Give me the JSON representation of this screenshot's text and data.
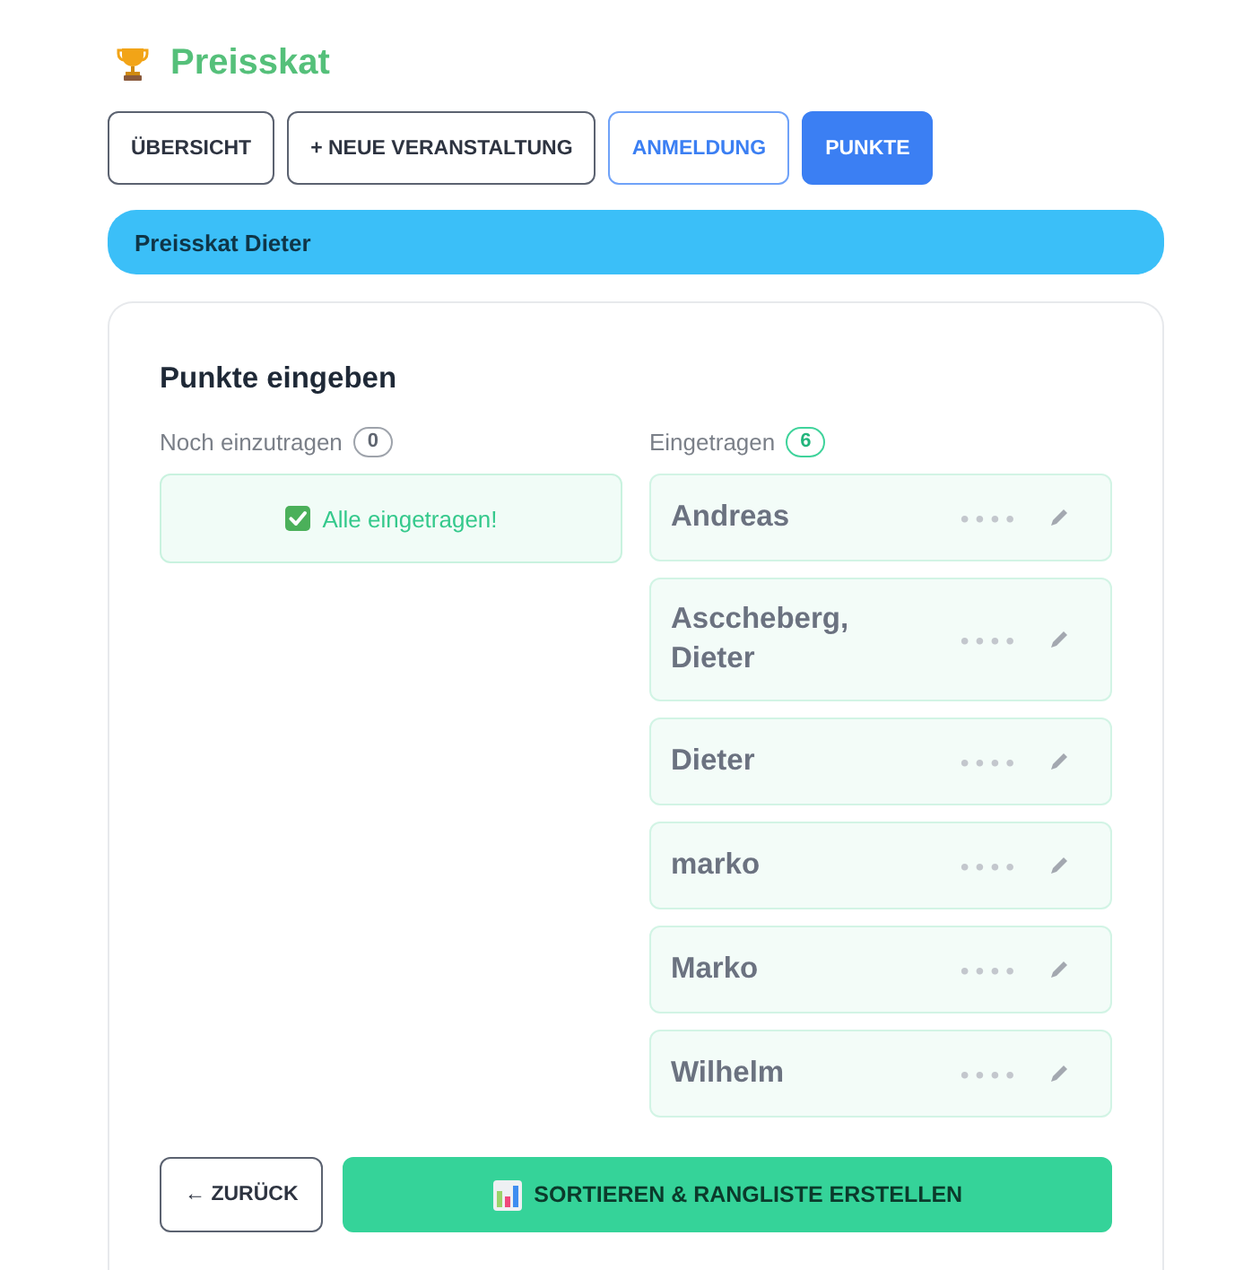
{
  "header": {
    "title": "Preisskat"
  },
  "nav_tabs": [
    {
      "label": "ÜBERSICHT",
      "kind": "neutral",
      "selected": false
    },
    {
      "label": "+ NEUE VERANSTALTUNG",
      "kind": "neutral",
      "selected": false
    },
    {
      "label": "ANMELDUNG",
      "kind": "primary",
      "selected": false
    },
    {
      "label": "PUNKTE",
      "kind": "primary",
      "selected": true
    }
  ],
  "event_banner": {
    "title": "Preisskat Dieter"
  },
  "card": {
    "title": "Punkte eingeben",
    "pending": {
      "label": "Noch einzutragen",
      "count": "0",
      "kind": "neutral",
      "empty_message": "Alle eingetragen!"
    },
    "entered": {
      "label": "Eingetragen",
      "count": "6",
      "kind": "success",
      "players": [
        {
          "name": "Andreas",
          "masked_points": "••••"
        },
        {
          "name": "Asccheberg, Dieter",
          "masked_points": "••••"
        },
        {
          "name": "Dieter",
          "masked_points": "••••"
        },
        {
          "name": "marko",
          "masked_points": "••••"
        },
        {
          "name": "Marko",
          "masked_points": "••••"
        },
        {
          "name": "Wilhelm",
          "masked_points": "••••"
        }
      ]
    },
    "actions": [
      {
        "label": "← ZURÜCK",
        "kind": "back"
      },
      {
        "label": "SORTIEREN & RANGLISTE ERSTELLEN",
        "kind": "primary"
      }
    ]
  }
}
